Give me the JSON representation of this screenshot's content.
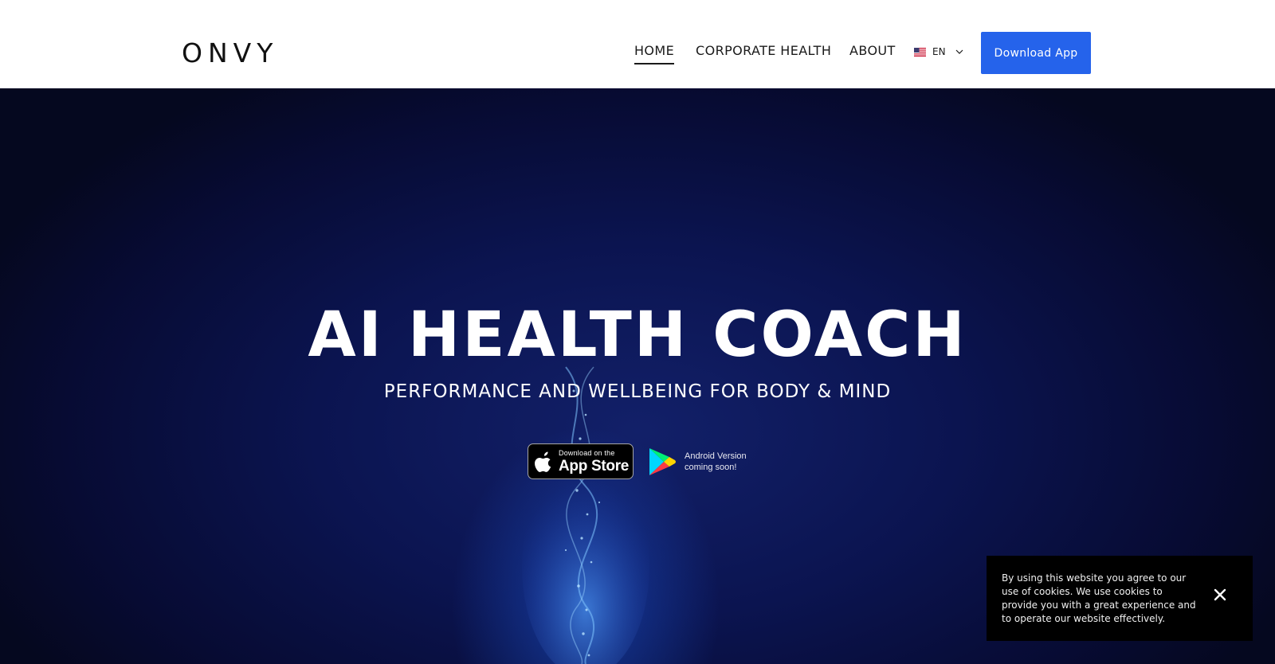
{
  "header": {
    "logo": "ONVY",
    "nav": [
      {
        "label": "HOME",
        "active": true
      },
      {
        "label": "CORPORATE HEALTH",
        "active": false
      },
      {
        "label": "ABOUT",
        "active": false
      }
    ],
    "language": {
      "label": "EN",
      "flag_icon": "us-flag-icon"
    },
    "cta_label": "Download App"
  },
  "hero": {
    "title": "AI HEALTH COACH",
    "subtitle": "PERFORMANCE AND WELLBEING FOR BODY & MIND",
    "app_store": {
      "small": "Download on the",
      "big": "App Store"
    },
    "android": {
      "text": "Android Version\ncoming soon!"
    }
  },
  "cookie": {
    "text": "By using this website you agree to our use of cookies. We use cookies to provide you with a great experience and to operate our website effectively.",
    "close_icon": "close-icon"
  },
  "colors": {
    "accent": "#2563eb",
    "hero_bg": "#0b1450",
    "cookie_bg": "#000000"
  }
}
